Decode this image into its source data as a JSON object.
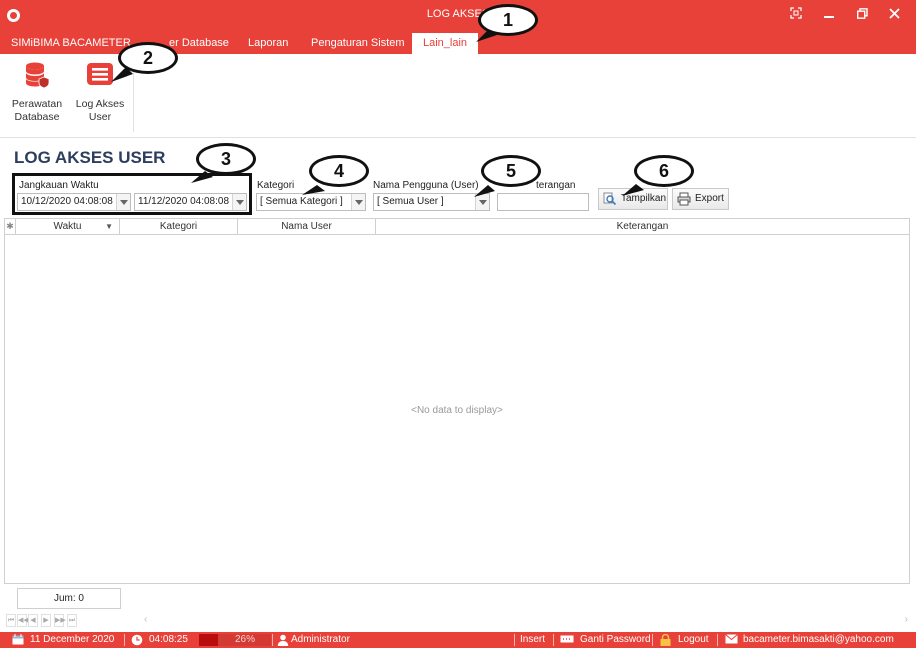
{
  "window": {
    "title": "LOG AKSES USER",
    "title_visible": "LOG AKSES"
  },
  "ribbon": {
    "tabs": [
      {
        "label": "SIMiBIMA BACAMETER"
      },
      {
        "label": "Master Database",
        "visible": "er Database"
      },
      {
        "label": "Laporan"
      },
      {
        "label": "Pengaturan Sistem"
      },
      {
        "label": "Lain_lain",
        "active": true
      }
    ],
    "buttons": [
      {
        "label": "Perawatan Database",
        "line1": "Perawatan",
        "line2": "Database",
        "icon": "database-icon"
      },
      {
        "label": "Log Akses User",
        "line1": "Log Akses",
        "line2": "User",
        "icon": "log-list-icon"
      }
    ]
  },
  "page": {
    "title": "LOG AKSES USER"
  },
  "filters": {
    "date_range_label": "Jangkauan Waktu",
    "date_from": "10/12/2020 04:08:08",
    "date_to": "11/12/2020 04:08:08",
    "category_label": "Kategori",
    "category_value": "[ Semua Kategori ]",
    "user_label": "Nama Pengguna (User)",
    "user_value": "[ Semua User ]",
    "keterangan_label": "Keterangan",
    "keterangan_visible": "terangan",
    "keterangan_value": "",
    "show_button": "Tampilkan",
    "export_button": "Export"
  },
  "grid": {
    "columns": [
      "Waktu",
      "Kategori",
      "Nama User",
      "Keterangan"
    ],
    "empty_text": "<No data to display>",
    "count_text": "Jum: 0"
  },
  "statusbar": {
    "date": "11 December 2020",
    "time": "04:08:25",
    "progress_text": "26%",
    "progress_value": 26,
    "user": "Administrator",
    "insert": "Insert",
    "change_password": "Ganti Password",
    "logout": "Logout",
    "email": "bacameter.bimasakti@yahoo.com"
  },
  "callouts": [
    "1",
    "2",
    "3",
    "4",
    "5",
    "6"
  ],
  "colors": {
    "accent": "#e8413a",
    "title_text": "#2d3e5c"
  }
}
